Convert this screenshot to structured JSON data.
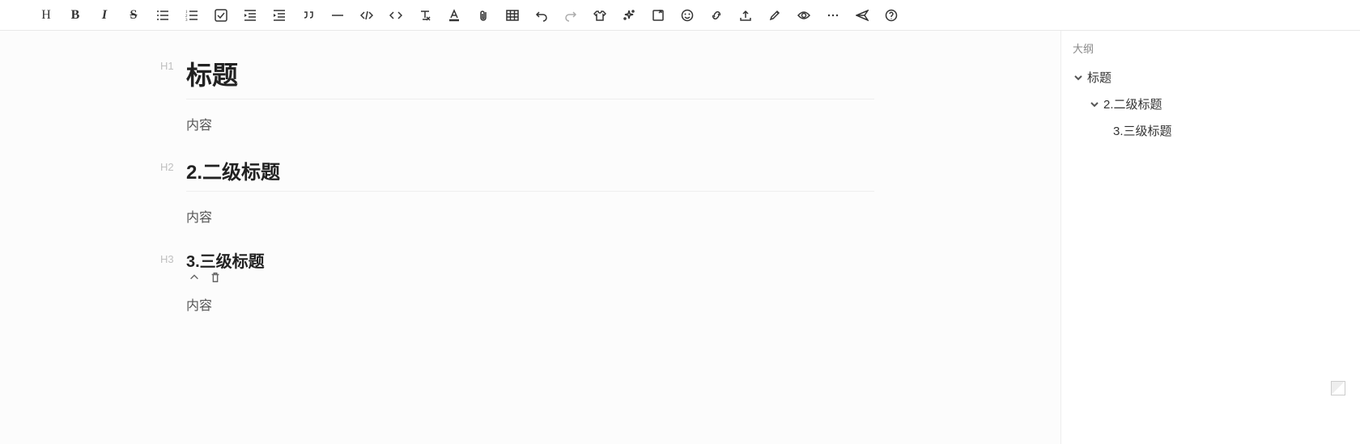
{
  "toolbar": {
    "heading": "H",
    "bold": "B",
    "italic": "I",
    "strike": "S"
  },
  "doc": {
    "h1_gutter": "H1",
    "h1_text": "标题",
    "p1_text": "内容",
    "h2_gutter": "H2",
    "h2_text": "2.二级标题",
    "p2_text": "内容",
    "h3_gutter": "H3",
    "h3_text": "3.三级标题",
    "p3_text": "内容"
  },
  "outline": {
    "title": "大纲",
    "items": [
      {
        "label": "标题",
        "level": 1,
        "expanded": true
      },
      {
        "label": "2.二级标题",
        "level": 2,
        "expanded": true
      },
      {
        "label": "3.三级标题",
        "level": 3,
        "expanded": false
      }
    ]
  }
}
